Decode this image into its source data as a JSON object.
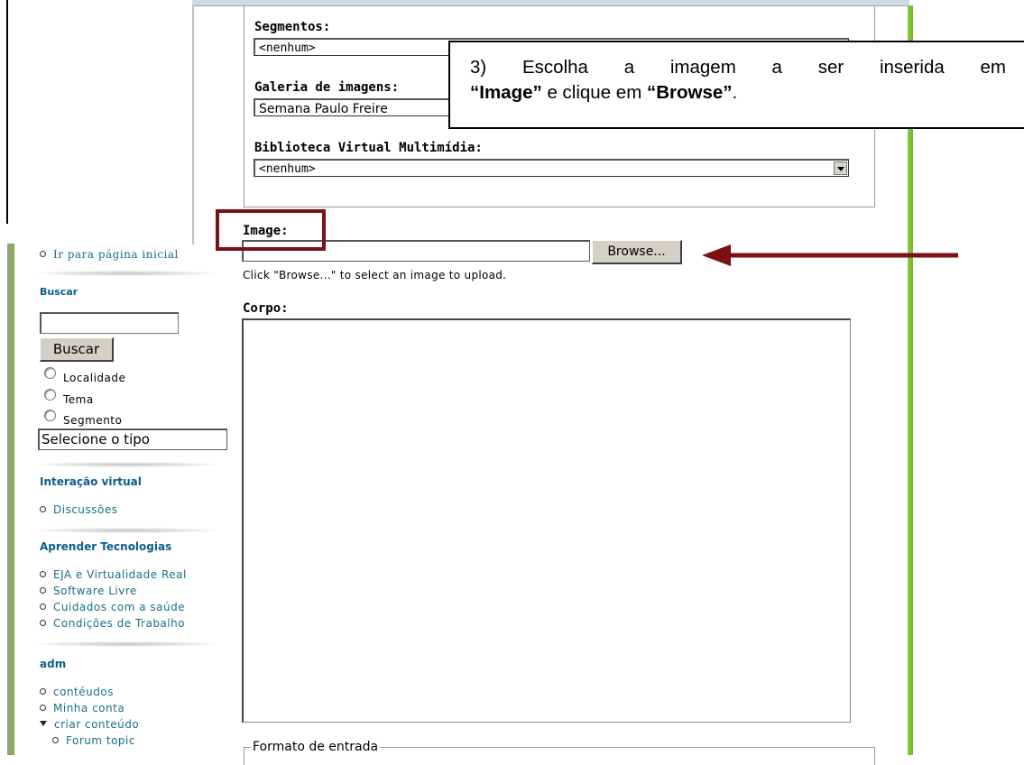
{
  "form": {
    "segmentos_label": "Segmentos:",
    "segmentos_value": "<nenhum>",
    "galeria_label": "Galeria de imagens:",
    "galeria_value": "Semana Paulo Freire",
    "biblioteca_label": "Biblioteca Virtual Multimídia:",
    "biblioteca_value": "<nenhum>",
    "image_label": "Image:",
    "image_value": "",
    "browse_label": "Browse...",
    "image_help": "Click \"Browse...\" to select an image to upload.",
    "corpo_label": "Corpo:",
    "formato_label": "Formato de entrada"
  },
  "callout": {
    "line1": "3) Escolha a imagem a ser inserida em",
    "bold1": "“Image”",
    "mid": " e clique em ",
    "bold2": "“Browse”",
    "end": "."
  },
  "sidebar": {
    "home_link": "Ir para página inicial",
    "buscar_heading": "Buscar",
    "search_value": "",
    "buscar_button": "Buscar",
    "radios": [
      "Localidade",
      "Tema",
      "Segmento"
    ],
    "tipo_select": "Selecione o tipo",
    "interacao_heading": "Interação virtual",
    "interacao_items": [
      "Discussões"
    ],
    "aprender_heading": "Aprender Tecnologias",
    "aprender_items": [
      "EJA e Virtualidade Real",
      "Software Livre",
      "Cuidados com a saúde",
      "Condições de Trabalho"
    ],
    "adm_heading": "adm",
    "adm_items": [
      "contéudos",
      "Minha conta",
      "criar conteúdo"
    ],
    "adm_subitems": [
      "Forum topic"
    ]
  },
  "colors": {
    "annotation": "#7b1113",
    "sidebar_link": "#1a6e8c",
    "sidebar_heading": "#0b5e89",
    "accent_green": "#7cbf2f"
  }
}
